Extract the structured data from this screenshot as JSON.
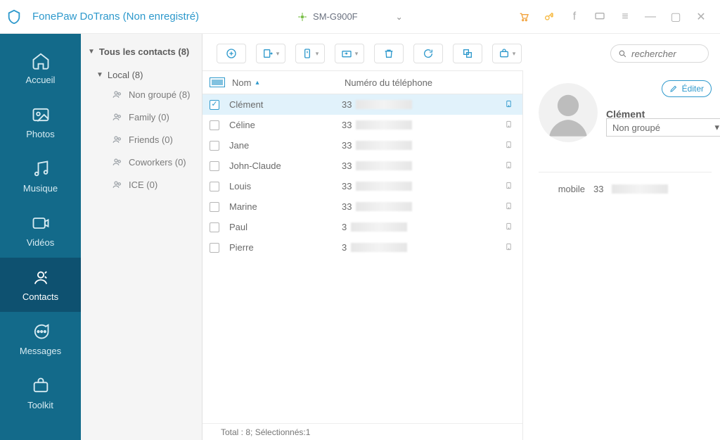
{
  "app": {
    "title": "FonePaw DoTrans (Non enregistré)"
  },
  "device": {
    "name": "SM-G900F"
  },
  "nav": {
    "accueil": "Accueil",
    "photos": "Photos",
    "musique": "Musique",
    "videos": "Vidéos",
    "contacts": "Contacts",
    "messages": "Messages",
    "toolkit": "Toolkit"
  },
  "tree": {
    "all": "Tous les contacts  (8)",
    "local": "Local  (8)",
    "groups": {
      "nongroupe": "Non groupé  (8)",
      "family": "Family  (0)",
      "friends": "Friends  (0)",
      "coworkers": "Coworkers  (0)",
      "ice": "ICE  (0)"
    }
  },
  "search": {
    "placeholder": "rechercher"
  },
  "table": {
    "col_name": "Nom",
    "col_phone": "Numéro du téléphone",
    "rows": [
      {
        "name": "Clément",
        "phone_prefix": "33",
        "selected": true
      },
      {
        "name": "Céline",
        "phone_prefix": "33",
        "selected": false
      },
      {
        "name": "Jane",
        "phone_prefix": "33",
        "selected": false
      },
      {
        "name": "John-Claude",
        "phone_prefix": "33",
        "selected": false
      },
      {
        "name": "Louis",
        "phone_prefix": "33",
        "selected": false
      },
      {
        "name": "Marine",
        "phone_prefix": "33",
        "selected": false
      },
      {
        "name": "Paul",
        "phone_prefix": "3",
        "selected": false
      },
      {
        "name": "Pierre",
        "phone_prefix": "3",
        "selected": false
      }
    ]
  },
  "detail": {
    "edit": "Éditer",
    "name": "Clément",
    "group_selected": "Non groupé",
    "phone_label": "mobile",
    "phone_prefix": "33"
  },
  "footer": {
    "text": "Total : 8; Sélectionnés:1"
  }
}
